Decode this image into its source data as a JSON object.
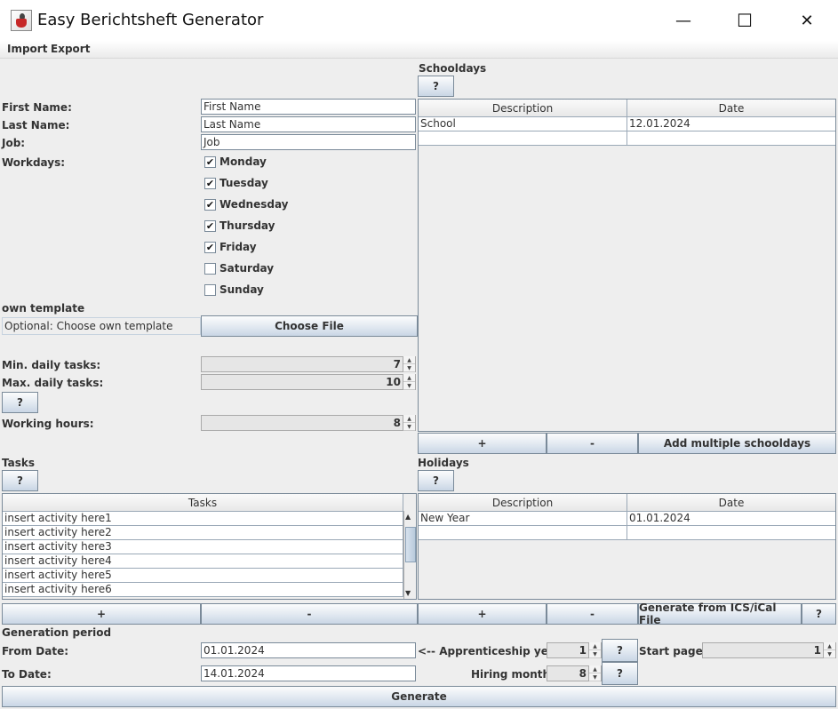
{
  "window": {
    "title": "Easy Berichtsheft Generator",
    "minimize": "—",
    "maximize": "☐",
    "close": "✕"
  },
  "menu": {
    "import": "Import",
    "export": "Export"
  },
  "form": {
    "first_name_label": "First Name:",
    "first_name_value": "First Name",
    "last_name_label": "Last Name:",
    "last_name_value": "Last Name",
    "job_label": "Job:",
    "job_value": "Job",
    "workdays_label": "Workdays:",
    "days": [
      {
        "label": "Monday",
        "checked": true
      },
      {
        "label": "Tuesday",
        "checked": true
      },
      {
        "label": "Wednesday",
        "checked": true
      },
      {
        "label": "Thursday",
        "checked": true
      },
      {
        "label": "Friday",
        "checked": true
      },
      {
        "label": "Saturday",
        "checked": false
      },
      {
        "label": "Sunday",
        "checked": false
      }
    ],
    "own_template_label": "own template",
    "template_placeholder": "Optional: Choose own template",
    "choose_file": "Choose File",
    "min_tasks_label": "Min. daily tasks:",
    "min_tasks_value": "7",
    "max_tasks_label": "Max. daily tasks:",
    "max_tasks_value": "10",
    "help": "?",
    "working_hours_label": "Working hours:",
    "working_hours_value": "8"
  },
  "schooldays": {
    "title": "Schooldays",
    "help": "?",
    "columns": [
      "Description",
      "Date"
    ],
    "rows": [
      [
        "School",
        "12.01.2024"
      ],
      [
        "",
        ""
      ]
    ],
    "add": "+",
    "remove": "-",
    "add_multiple": "Add multiple schooldays"
  },
  "tasks": {
    "title": "Tasks",
    "help": "?",
    "column": "Tasks",
    "rows": [
      "insert activity here1",
      "insert activity here2",
      "insert activity here3",
      "insert activity here4",
      "insert activity here5",
      "insert activity here6"
    ],
    "add": "+",
    "remove": "-"
  },
  "holidays": {
    "title": "Holidays",
    "help": "?",
    "columns": [
      "Description",
      "Date"
    ],
    "rows": [
      [
        "New Year",
        "01.01.2024"
      ],
      [
        "",
        ""
      ]
    ],
    "add": "+",
    "remove": "-",
    "generate_ics": "Generate from ICS/iCal File",
    "help2": "?"
  },
  "generation": {
    "title": "Generation period",
    "from_label": "From Date:",
    "from_value": "01.01.2024",
    "to_label": "To Date:",
    "to_value": "14.01.2024",
    "appr_label": "<-- Apprenticeship year:",
    "appr_value": "1",
    "hiring_label": "Hiring month:",
    "hiring_value": "8",
    "start_page_label": "Start page:",
    "start_page_value": "1",
    "help": "?",
    "generate": "Generate"
  }
}
